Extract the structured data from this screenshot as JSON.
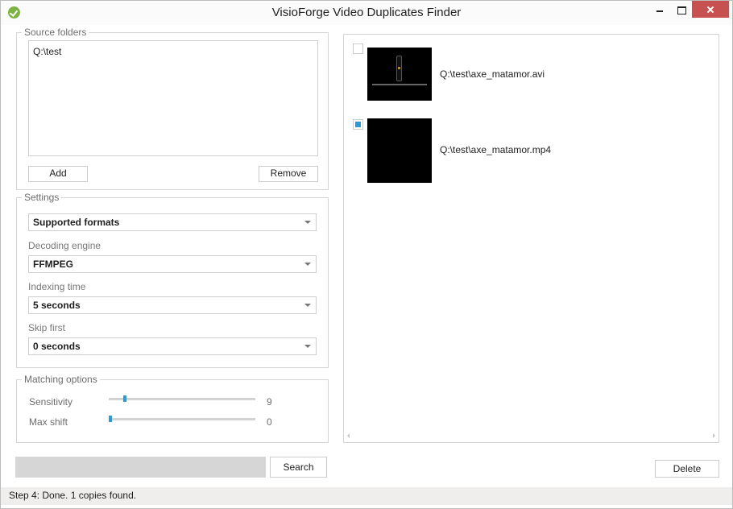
{
  "window": {
    "title": "VisioForge Video Duplicates Finder",
    "controls": [
      "minimize",
      "maximize",
      "close"
    ],
    "accent_color": "#2c9ad8",
    "close_color": "#c75050",
    "icon": "checkmark-leaf-icon"
  },
  "source_folders": {
    "legend": "Source folders",
    "items": [
      "Q:\\test"
    ],
    "add_label": "Add",
    "remove_label": "Remove"
  },
  "settings": {
    "legend": "Settings",
    "formats": {
      "value": "Supported formats"
    },
    "decoding_engine": {
      "label": "Decoding engine",
      "value": "FFMPEG"
    },
    "indexing_time": {
      "label": "Indexing time",
      "value": "5 seconds"
    },
    "skip_first": {
      "label": "Skip first",
      "value": "0 seconds"
    }
  },
  "matching": {
    "legend": "Matching options",
    "sensitivity": {
      "label": "Sensitivity",
      "value": "9",
      "fraction": 0.1
    },
    "max_shift": {
      "label": "Max shift",
      "value": "0",
      "fraction": 0.0
    }
  },
  "actions": {
    "progress_fraction": 0.0,
    "search_label": "Search",
    "delete_label": "Delete"
  },
  "results": [
    {
      "path": "Q:\\test\\axe_matamor.avi",
      "checked": false,
      "thumbnail": "video-frame-bottle"
    },
    {
      "path": "Q:\\test\\axe_matamor.mp4",
      "checked": true,
      "thumbnail": "black-frame"
    }
  ],
  "status": {
    "text": "Step 4: Done. 1 copies found."
  }
}
